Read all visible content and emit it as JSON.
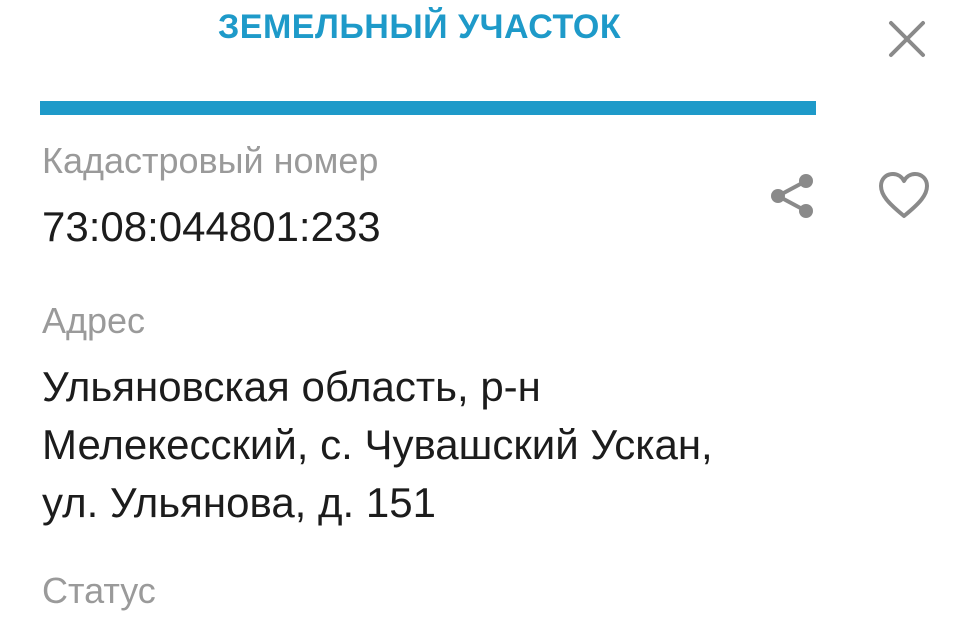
{
  "header": {
    "title": "ЗЕМЕЛЬНЫЙ УЧАСТОК",
    "close_icon": "close-icon"
  },
  "colors": {
    "accent": "#1e9ac9",
    "label": "#9a9a9a",
    "value": "#1c1c1c",
    "icon": "#8a8a8a"
  },
  "cadastral": {
    "label": "Кадастровый номер",
    "value": "73:08:044801:233",
    "share_icon": "share-icon",
    "favorite_icon": "heart-outline-icon"
  },
  "address": {
    "label": "Адрес",
    "lines": [
      "Ульяновская область, р-н",
      "Мелекесский, с. Чувашский Ускан,",
      "ул. Ульянова, д. 151"
    ]
  },
  "status": {
    "label": "Статус"
  }
}
